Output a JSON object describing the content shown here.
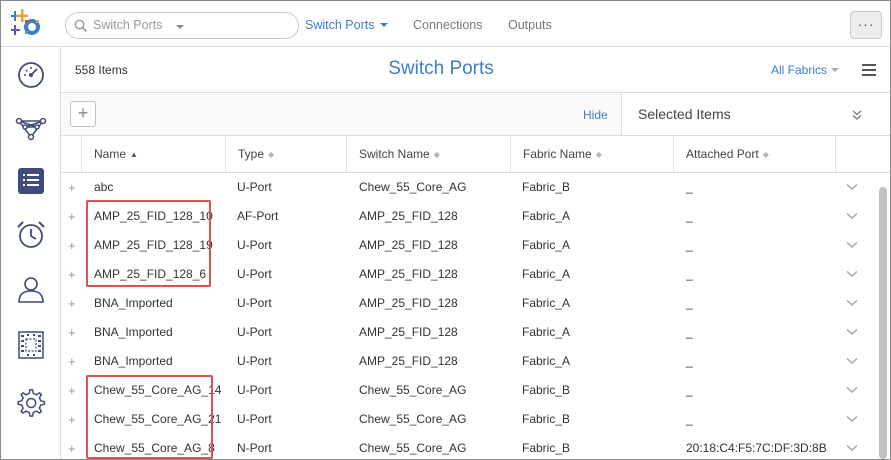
{
  "topbar": {
    "search_placeholder": "Switch Ports",
    "nav_items": [
      "Switch Ports",
      "Connections",
      "Outputs"
    ],
    "more_label": "···"
  },
  "sidebar": {
    "icons": [
      "dashboard-icon",
      "topology-icon",
      "inventory-list-icon",
      "alarm-clock-icon",
      "user-icon",
      "chassis-icon",
      "settings-gear-icon"
    ],
    "active_index": 2
  },
  "page": {
    "item_count": "558 Items",
    "title": "Switch Ports",
    "fabric_filter": "All Fabrics"
  },
  "toolbar": {
    "add_label": "+",
    "hide_label": "Hide",
    "selected_items_label": "Selected Items"
  },
  "table": {
    "columns": [
      "Name",
      "Type",
      "Switch Name",
      "Fabric Name",
      "Attached Port"
    ],
    "sorted_column": "Name",
    "rows": [
      [
        "abc",
        "U-Port",
        "Chew_55_Core_AG",
        "Fabric_B",
        "_"
      ],
      [
        "AMP_25_FID_128_10",
        "AF-Port",
        "AMP_25_FID_128",
        "Fabric_A",
        "_"
      ],
      [
        "AMP_25_FID_128_19",
        "U-Port",
        "AMP_25_FID_128",
        "Fabric_A",
        "_"
      ],
      [
        "AMP_25_FID_128_6",
        "U-Port",
        "AMP_25_FID_128",
        "Fabric_A",
        "_"
      ],
      [
        "BNA_Imported",
        "U-Port",
        "AMP_25_FID_128",
        "Fabric_A",
        "_"
      ],
      [
        "BNA_Imported",
        "U-Port",
        "AMP_25_FID_128",
        "Fabric_A",
        "_"
      ],
      [
        "BNA_Imported",
        "U-Port",
        "AMP_25_FID_128",
        "Fabric_A",
        "_"
      ],
      [
        "Chew_55_Core_AG_14",
        "U-Port",
        "Chew_55_Core_AG",
        "Fabric_B",
        "_"
      ],
      [
        "Chew_55_Core_AG_21",
        "U-Port",
        "Chew_55_Core_AG",
        "Fabric_B",
        "_"
      ],
      [
        "Chew_55_Core_AG_8",
        "N-Port",
        "Chew_55_Core_AG",
        "Fabric_B",
        "20:18:C4:F5:7C:DF:3D:8B"
      ]
    ]
  },
  "highlight_color": "#d9534f",
  "accent_color": "#3b7ec6"
}
